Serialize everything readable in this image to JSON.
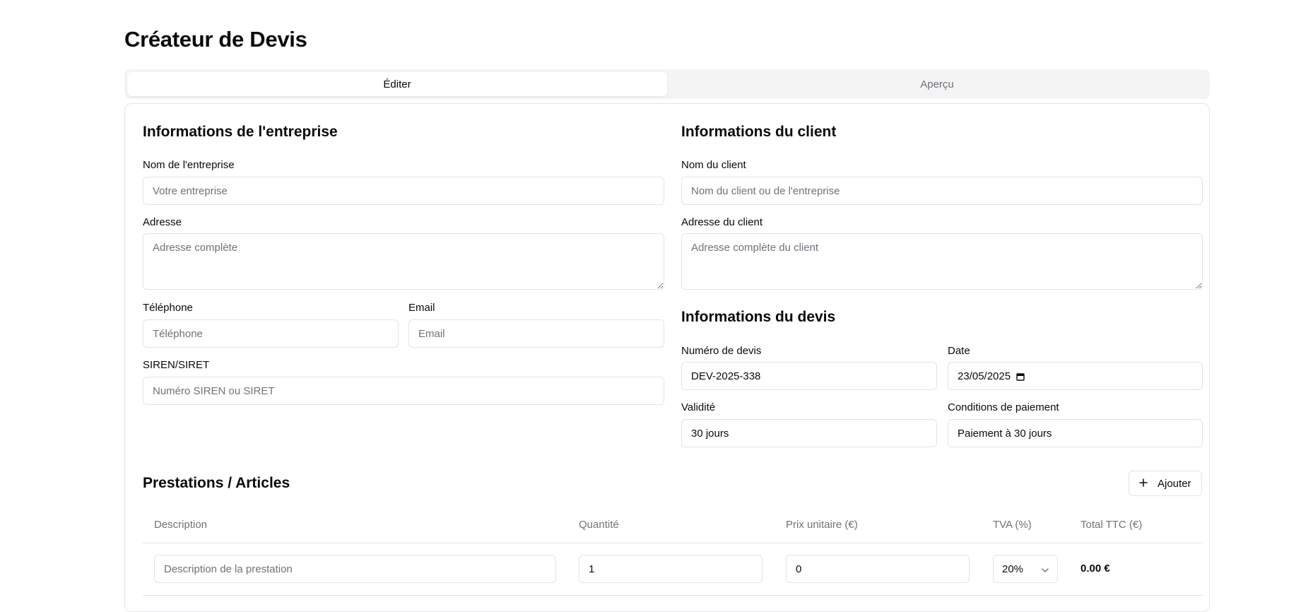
{
  "app": {
    "title": "Créateur de Devis"
  },
  "tabs": [
    {
      "label": "Éditer",
      "active": true
    },
    {
      "label": "Aperçu",
      "active": false
    }
  ],
  "company": {
    "heading": "Informations de l'entreprise",
    "name_label": "Nom de l'entreprise",
    "name_placeholder": "Votre entreprise",
    "address_label": "Adresse",
    "address_placeholder": "Adresse complète",
    "phone_label": "Téléphone",
    "phone_placeholder": "Téléphone",
    "email_label": "Email",
    "email_placeholder": "Email",
    "siren_label": "SIREN/SIRET",
    "siren_placeholder": "Numéro SIREN ou SIRET"
  },
  "client": {
    "heading": "Informations du client",
    "name_label": "Nom du client",
    "name_placeholder": "Nom du client ou de l'entreprise",
    "address_label": "Adresse du client",
    "address_placeholder": "Adresse complète du client"
  },
  "quote": {
    "heading": "Informations du devis",
    "number_label": "Numéro de devis",
    "number_value": "DEV-2025-338",
    "date_label": "Date",
    "date_value": "23/05/2025",
    "validity_label": "Validité",
    "validity_value": "30 jours",
    "payment_label": "Conditions de paiement",
    "payment_value": "Paiement à 30 jours"
  },
  "items": {
    "heading": "Prestations / Articles",
    "add_label": "Ajouter",
    "columns": [
      "Description",
      "Quantité",
      "Prix unitaire (€)",
      "TVA (%)",
      "Total TTC (€)"
    ],
    "rows": [
      {
        "description_placeholder": "Description de la prestation",
        "quantity": "1",
        "unit_price": "0",
        "vat": "20%",
        "total": "0.00 €"
      }
    ]
  },
  "icons": {
    "add": "plus-icon",
    "select": "chevron-down-icon",
    "date": "calendar-icon"
  }
}
